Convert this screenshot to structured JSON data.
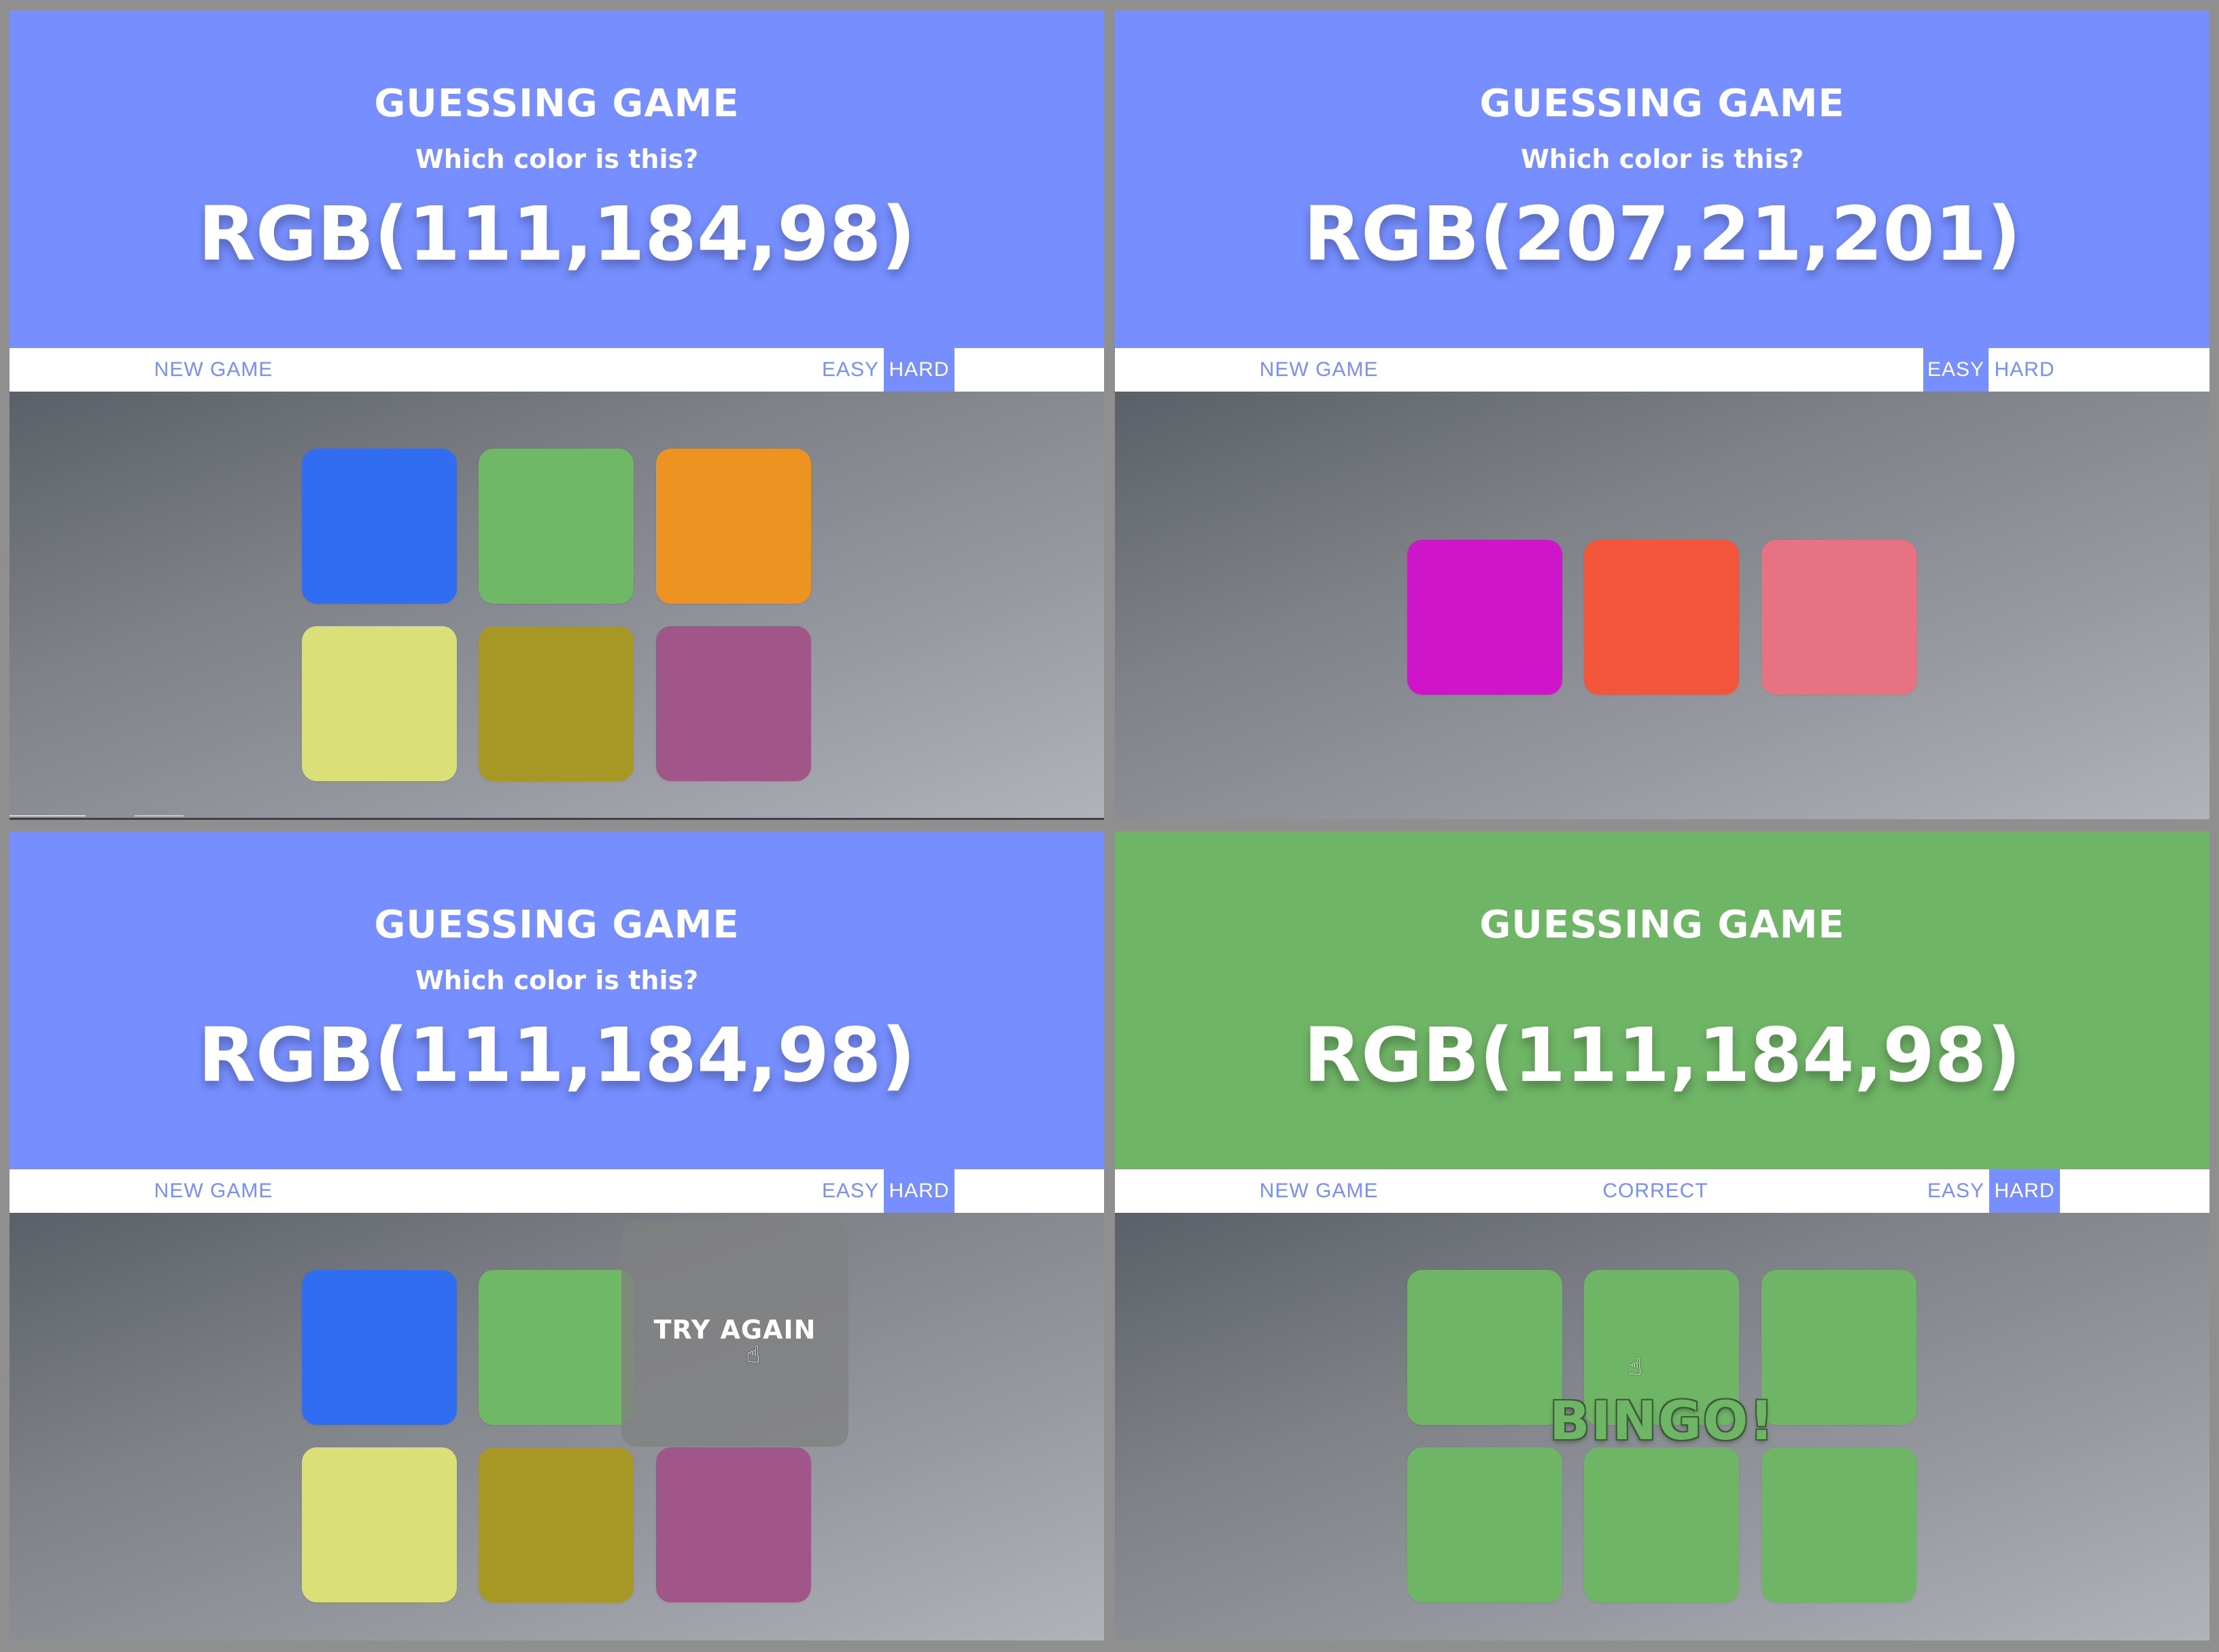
{
  "screens": [
    {
      "title": "GUESSING GAME",
      "subtitle": "Which color is this?",
      "rgb": "RGB(111,184,98)",
      "header_color": "#768eff",
      "nav": {
        "new_game": "NEW GAME",
        "message": "",
        "easy": "EASY",
        "hard": "HARD",
        "active": "hard"
      },
      "overlay": "",
      "squares": [
        {
          "color": "#316df0"
        },
        {
          "color": "#6fb866"
        },
        {
          "color": "#ec9321"
        },
        {
          "color": "#dadf77"
        },
        {
          "color": "#a79826"
        },
        {
          "color": "#a05688"
        }
      ]
    },
    {
      "title": "GUESSING GAME",
      "subtitle": "Which color is this?",
      "rgb": "RGB(207,21,201)",
      "header_color": "#768eff",
      "nav": {
        "new_game": "NEW GAME",
        "message": "",
        "easy": "EASY",
        "hard": "HARD",
        "active": "easy"
      },
      "overlay": "",
      "squares": [
        {
          "color": "#cf15c9"
        },
        {
          "color": "#f3553b"
        },
        {
          "color": "#e67282"
        }
      ]
    },
    {
      "title": "GUESSING GAME",
      "subtitle": "Which color is this?",
      "rgb": "RGB(111,184,98)",
      "header_color": "#768eff",
      "nav": {
        "new_game": "NEW GAME",
        "message": "",
        "easy": "EASY",
        "hard": "HARD",
        "active": "hard"
      },
      "overlay": "TRY AGAIN",
      "squares": [
        {
          "color": "#316df0"
        },
        {
          "color": "#6fb866"
        },
        {
          "color": "#808080"
        },
        {
          "color": "#dadf77"
        },
        {
          "color": "#a79826"
        },
        {
          "color": "#a05688"
        }
      ]
    },
    {
      "title": "GUESSING GAME",
      "subtitle": "",
      "rgb": "RGB(111,184,98)",
      "header_color": "#6fb566",
      "nav": {
        "new_game": "NEW GAME",
        "message": "CORRECT",
        "easy": "EASY",
        "hard": "HARD",
        "active": "hard"
      },
      "overlay": "BINGO!",
      "squares": [
        {
          "color": "#6fb566"
        },
        {
          "color": "#6fb566"
        },
        {
          "color": "#6fb566"
        },
        {
          "color": "#6fb566"
        },
        {
          "color": "#6fb566"
        },
        {
          "color": "#6fb566"
        }
      ]
    }
  ],
  "colors": {
    "accent": "#768eff",
    "correct": "#6fb566",
    "white": "#ffffff"
  }
}
